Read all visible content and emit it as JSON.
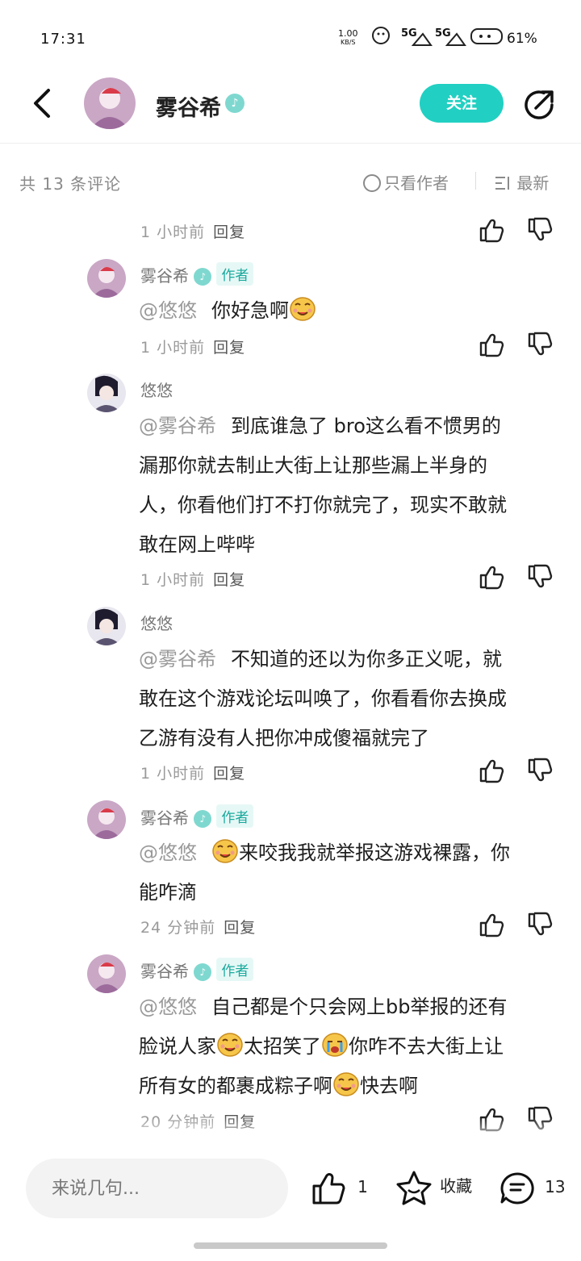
{
  "status": {
    "time": "17:31",
    "speed": "1.00",
    "speed_unit": "KB/S",
    "sig1": "5G",
    "sig2": "5G",
    "battery": "61%"
  },
  "header": {
    "title": "雾谷希",
    "follow_label": "关注"
  },
  "filter": {
    "count_text": "共 13 条评论",
    "only_author": "只看作者",
    "sort": "最新"
  },
  "author_tag": "作者",
  "reply_label": "回复",
  "comments": [
    {
      "time": "1 小时前"
    },
    {
      "user": "雾谷希",
      "is_author": true,
      "mention": "@悠悠",
      "lines": [
        "你好急啊"
      ],
      "time": "1 小时前"
    },
    {
      "user": "悠悠",
      "mention": "@雾谷希",
      "lines": [
        "到底谁急了 bro这么看不惯男的",
        "漏那你就去制止大街上让那些漏上半身的",
        "人，你看他们打不打你就完了，现实不敢就",
        "敢在网上哔哔"
      ],
      "time": "1 小时前"
    },
    {
      "user": "悠悠",
      "mention": "@雾谷希",
      "lines": [
        "不知道的还以为你多正义呢，就",
        "敢在这个游戏论坛叫唤了，你看看你去换成",
        "乙游有没有人把你冲成傻福就完了"
      ],
      "time": "1 小时前"
    },
    {
      "user": "雾谷希",
      "is_author": true,
      "mention": "@悠悠",
      "lines": [
        "来咬我我就举报这游戏裸露，你",
        "能咋滴"
      ],
      "time": "24 分钟前"
    },
    {
      "user": "雾谷希",
      "is_author": true,
      "mention": "@悠悠",
      "lines": [
        "自己都是个只会网上bb举报的还有",
        "脸说人家",
        "太招笑了",
        "你咋不去大街上让",
        "所有女的都裹成粽子啊",
        "快去啊"
      ],
      "time": "20 分钟前"
    }
  ],
  "bottom": {
    "placeholder": "来说几句...",
    "like_count": "1",
    "fav_label": "收藏",
    "comment_count": "13"
  },
  "colors": {
    "accent": "#21d0c2",
    "author_tag_bg": "#e6f8f6",
    "author_tag_text": "#1aa99d"
  },
  "icons": [
    "back-arrow-icon",
    "share-icon",
    "thumb-up-icon",
    "thumb-down-icon",
    "star-icon",
    "comment-icon",
    "sort-icon",
    "verified-badge-icon"
  ]
}
